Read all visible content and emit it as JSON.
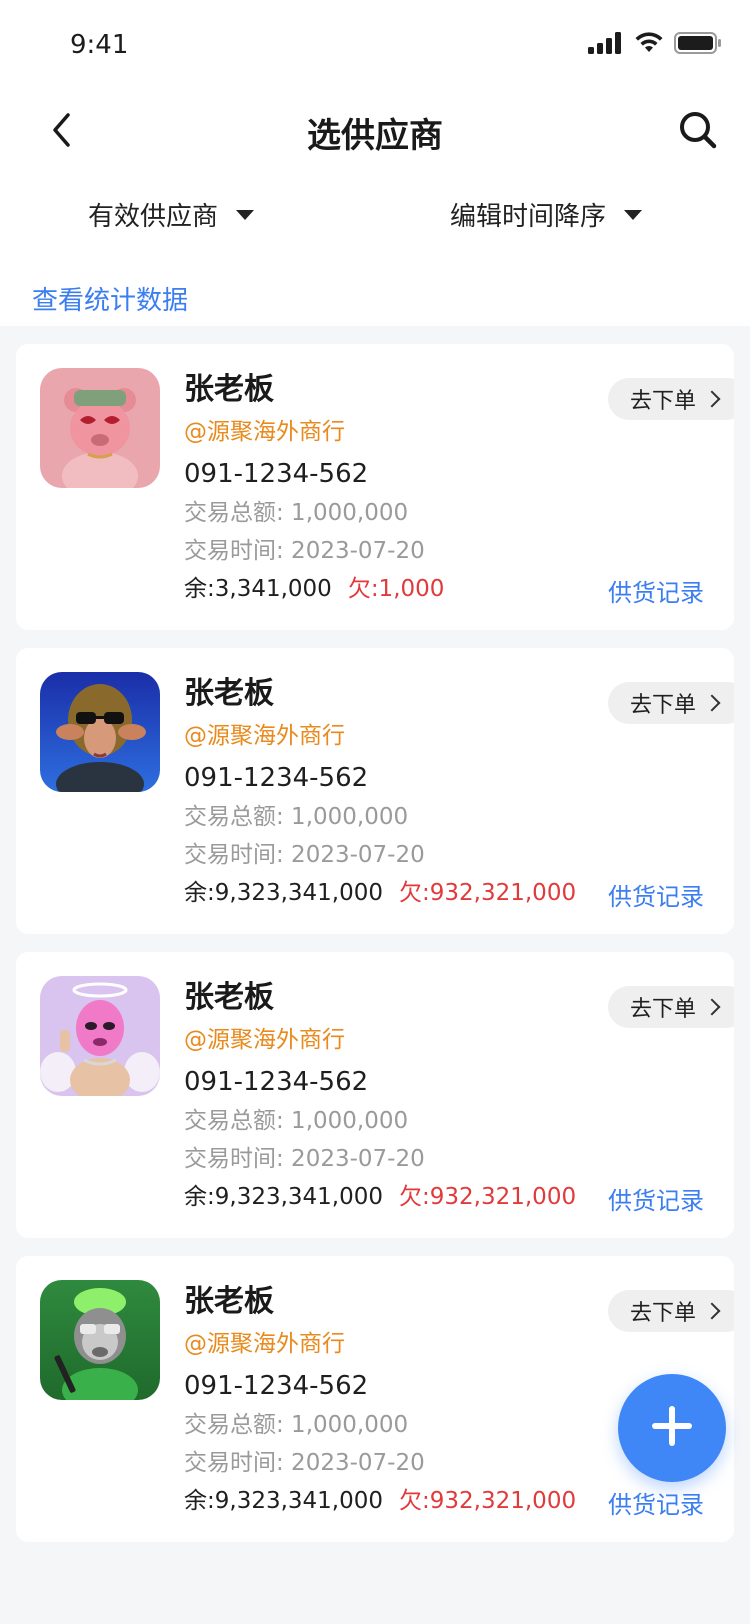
{
  "status_bar": {
    "time": "9:41",
    "icons": [
      "signal-icon",
      "wifi-icon",
      "battery-icon"
    ]
  },
  "header": {
    "title": "选供应商",
    "back_icon": "back-chevron-icon",
    "search_icon": "search-icon"
  },
  "filters": {
    "status_filter": "有效供应商",
    "sort_filter": "编辑时间降序"
  },
  "stats_link": "查看统计数据",
  "suppliers": [
    {
      "name": "张老板",
      "company": "@源聚海外商行",
      "phone": "091-1234-562",
      "total": "交易总额: 1,000,000",
      "time": "交易时间: 2023-07-20",
      "balance": "余:3,341,000",
      "debt": "欠:1,000",
      "order_label": "去下单",
      "records_label": "供货记录",
      "avatar": "pink-bear-avatar"
    },
    {
      "name": "张老板",
      "company": "@源聚海外商行",
      "phone": "091-1234-562",
      "total": "交易总额: 1,000,000",
      "time": "交易时间: 2023-07-20",
      "balance": "余:9,323,341,000",
      "debt": "欠:932,321,000",
      "order_label": "去下单",
      "records_label": "供货记录",
      "avatar": "sheep-sunglasses-avatar"
    },
    {
      "name": "张老板",
      "company": "@源聚海外商行",
      "phone": "091-1234-562",
      "total": "交易总额: 1,000,000",
      "time": "交易时间: 2023-07-20",
      "balance": "余:9,323,341,000",
      "debt": "欠:932,321,000",
      "order_label": "去下单",
      "records_label": "供货记录",
      "avatar": "pink-mask-angel-avatar"
    },
    {
      "name": "张老板",
      "company": "@源聚海外商行",
      "phone": "091-1234-562",
      "total": "交易总额: 1,000,000",
      "time": "交易时间: 2023-07-20",
      "balance": "余:9,323,341,000",
      "debt": "欠:932,321,000",
      "order_label": "去下单",
      "records_label": "供货记录",
      "avatar": "green-monkey-avatar"
    }
  ],
  "fab": {
    "icon": "plus-icon"
  },
  "colors": {
    "accent_blue": "#3b7ef0",
    "company_orange": "#e88a1c",
    "debt_red": "#e03a3a",
    "fab_blue": "#3f86f6"
  }
}
